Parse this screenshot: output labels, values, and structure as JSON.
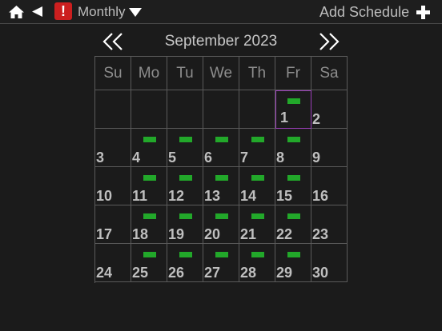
{
  "toolbar": {
    "view_label": "Monthly",
    "add_label": "Add Schedule",
    "alert_symbol": "!"
  },
  "calendar": {
    "month_title": "September 2023",
    "weekdays": [
      "Su",
      "Mo",
      "Tu",
      "We",
      "Th",
      "Fr",
      "Sa"
    ],
    "selected_day": 1,
    "days": [
      {
        "day": "",
        "has_event": false
      },
      {
        "day": "",
        "has_event": false
      },
      {
        "day": "",
        "has_event": false
      },
      {
        "day": "",
        "has_event": false
      },
      {
        "day": "",
        "has_event": false
      },
      {
        "day": "1",
        "has_event": true
      },
      {
        "day": "2",
        "has_event": false
      },
      {
        "day": "3",
        "has_event": false
      },
      {
        "day": "4",
        "has_event": true
      },
      {
        "day": "5",
        "has_event": true
      },
      {
        "day": "6",
        "has_event": true
      },
      {
        "day": "7",
        "has_event": true
      },
      {
        "day": "8",
        "has_event": true
      },
      {
        "day": "9",
        "has_event": false
      },
      {
        "day": "10",
        "has_event": false
      },
      {
        "day": "11",
        "has_event": true
      },
      {
        "day": "12",
        "has_event": true
      },
      {
        "day": "13",
        "has_event": true
      },
      {
        "day": "14",
        "has_event": true
      },
      {
        "day": "15",
        "has_event": true
      },
      {
        "day": "16",
        "has_event": false
      },
      {
        "day": "17",
        "has_event": false
      },
      {
        "day": "18",
        "has_event": true
      },
      {
        "day": "19",
        "has_event": true
      },
      {
        "day": "20",
        "has_event": true
      },
      {
        "day": "21",
        "has_event": true
      },
      {
        "day": "22",
        "has_event": true
      },
      {
        "day": "23",
        "has_event": false
      },
      {
        "day": "24",
        "has_event": false
      },
      {
        "day": "25",
        "has_event": true
      },
      {
        "day": "26",
        "has_event": true
      },
      {
        "day": "27",
        "has_event": true
      },
      {
        "day": "28",
        "has_event": true
      },
      {
        "day": "29",
        "has_event": true
      },
      {
        "day": "30",
        "has_event": false
      }
    ]
  },
  "colors": {
    "event_indicator": "#22a82a",
    "selected_outline": "#9a3fb8",
    "alert": "#cc1f1f"
  }
}
